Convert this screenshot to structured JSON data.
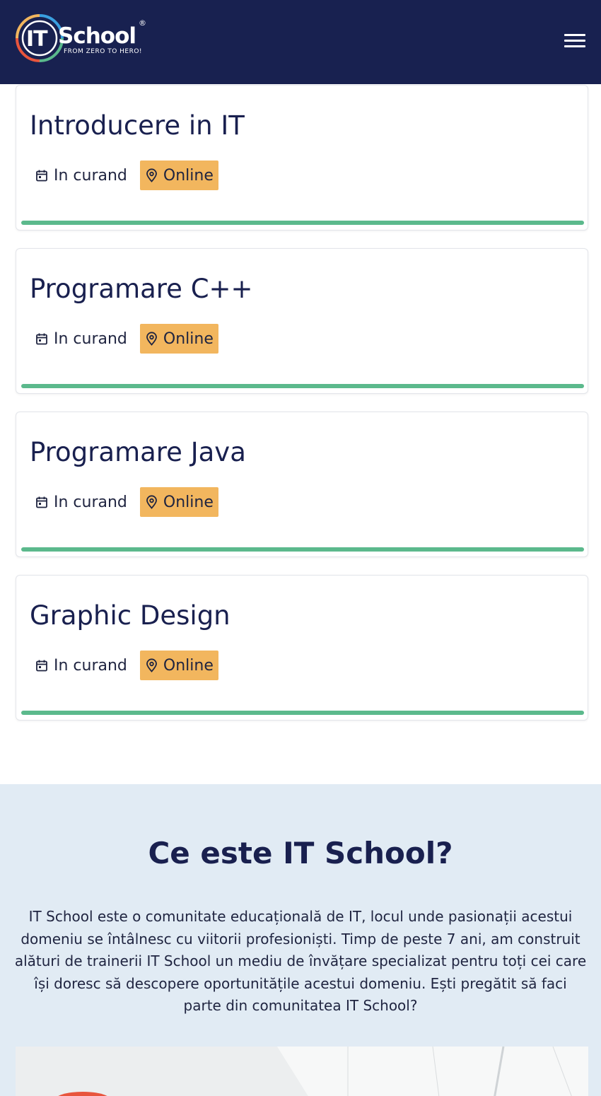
{
  "header": {
    "logo": {
      "mark": "IT",
      "word": "School",
      "tagline": "FROM ZERO TO HERO!",
      "registered": "®"
    },
    "menu_icon": "hamburger-menu-icon"
  },
  "courses": [
    {
      "title": "Introducere in IT",
      "date": "In curand",
      "location": "Online"
    },
    {
      "title": "Programare C++",
      "date": "In curand",
      "location": "Online"
    },
    {
      "title": "Programare Java",
      "date": "In curand",
      "location": "Online"
    },
    {
      "title": "Graphic Design",
      "date": "In curand",
      "location": "Online"
    }
  ],
  "about": {
    "title": "Ce este IT School?",
    "text": "IT School este o comunitate educațională de IT, locul unde pasionații acestui domeniu se întâlnesc cu viitorii profesioniști. Timp de peste 7 ani, am construit alături de trainerii IT School un mediu de învățare specializat pentru toți cei care își doresc să descopere oportunitățile acestui domeniu. Ești pregătit să faci parte din comunitatea IT School?"
  },
  "colors": {
    "header_bg": "#182150",
    "title": "#19204f",
    "location_badge": "#f2b65e",
    "card_bar": "#5bb98c",
    "about_bg": "#e1ebf4"
  }
}
